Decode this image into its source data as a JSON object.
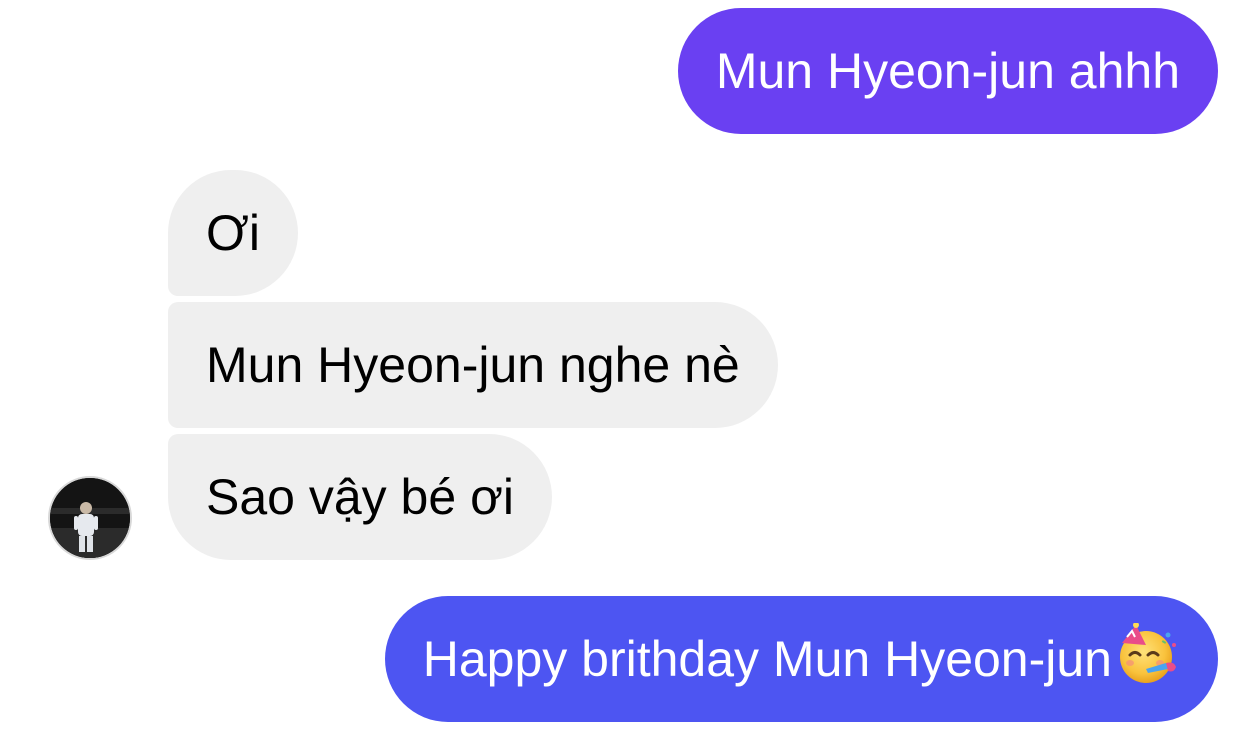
{
  "messages": [
    {
      "id": "msg1",
      "direction": "sent",
      "text": "Mun Hyeon-jun ahhh",
      "bubble_color": "#6a40f2"
    },
    {
      "id": "msg2",
      "direction": "received",
      "text": "Ơi",
      "bubble_color": "#efefef"
    },
    {
      "id": "msg3",
      "direction": "received",
      "text": "Mun Hyeon-jun nghe nè",
      "bubble_color": "#efefef"
    },
    {
      "id": "msg4",
      "direction": "received",
      "text": "Sao vậy bé ơi",
      "bubble_color": "#efefef"
    },
    {
      "id": "msg5",
      "direction": "sent",
      "text": "Happy brithday Mun Hyeon-jun",
      "emoji": "partying-face-icon",
      "bubble_color": "#4d55f2"
    }
  ],
  "contact": {
    "avatar": "contact-avatar"
  }
}
